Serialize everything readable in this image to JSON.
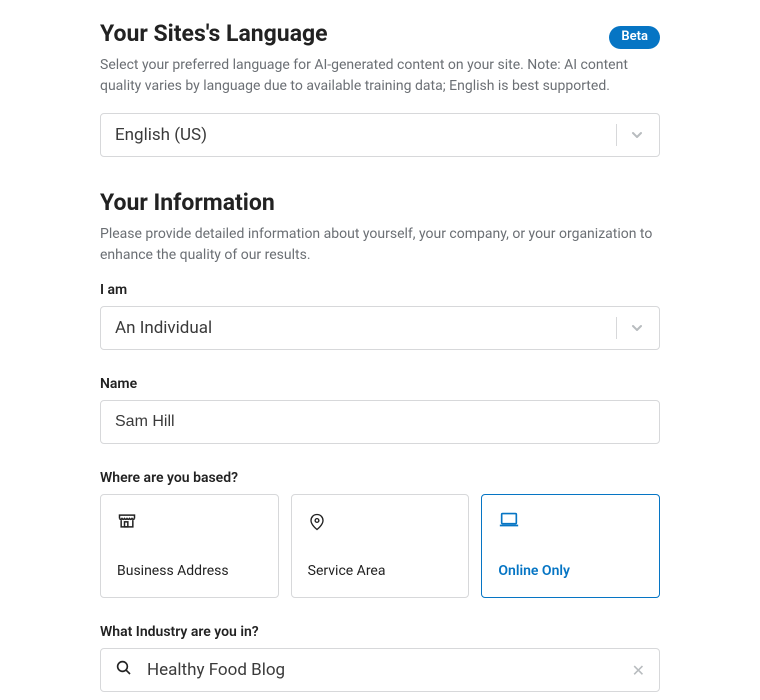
{
  "language_section": {
    "title": "Your Sites's Language",
    "badge": "Beta",
    "description": "Select your preferred language for AI-generated content on your site. Note: AI content quality varies by language due to available training data; English is best supported.",
    "selected": "English (US)"
  },
  "info_section": {
    "title": "Your Information",
    "description": "Please provide detailed information about yourself, your company, or your organization to enhance the quality of our results.",
    "iam": {
      "label": "I am",
      "selected": "An Individual"
    },
    "name": {
      "label": "Name",
      "value": "Sam Hill"
    },
    "based": {
      "label": "Where are you based?",
      "options": {
        "business": "Business Address",
        "service": "Service Area",
        "online": "Online Only"
      }
    },
    "industry": {
      "label": "What Industry are you in?",
      "value": "Healthy Food Blog"
    }
  }
}
